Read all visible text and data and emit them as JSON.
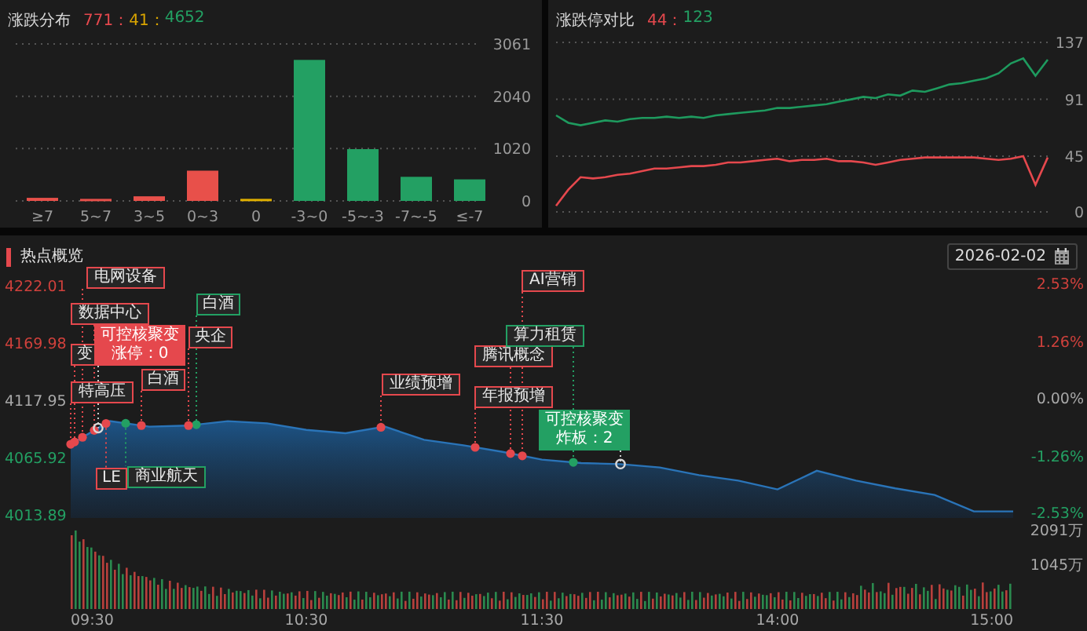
{
  "distribution": {
    "title": "涨跌分布",
    "counts": [
      {
        "text": "771：",
        "color": "#e5484d"
      },
      {
        "text": "41：",
        "color": "#d9a400"
      },
      {
        "text": "4652",
        "color": "#23a063"
      }
    ],
    "chart_data": {
      "type": "bar",
      "categories": [
        "≥7",
        "5~7",
        "3~5",
        "0~3",
        "0",
        "-3~0",
        "-5~-3",
        "-7~-5",
        "≤-7"
      ],
      "series": [
        {
          "color": "#e8504a",
          "values": [
            60,
            40,
            90,
            590,
            null,
            null,
            null,
            null,
            null
          ]
        },
        {
          "color": "#e0b000",
          "values": [
            null,
            null,
            null,
            null,
            40,
            null,
            null,
            null,
            null
          ]
        },
        {
          "color": "#23a063",
          "values": [
            null,
            null,
            null,
            null,
            null,
            2750,
            1010,
            470,
            420
          ]
        }
      ],
      "ylim": [
        0,
        3061
      ],
      "yticks": [
        0,
        1020,
        2040,
        3061
      ]
    }
  },
  "limit_compare": {
    "title": "涨跌停对比",
    "counts": [
      {
        "text": "44：",
        "color": "#e5484d"
      },
      {
        "text": "123",
        "color": "#23a063"
      }
    ],
    "chart_data": {
      "type": "line",
      "series": [
        {
          "color": "#1e9a5e",
          "values": [
            78,
            72,
            70,
            72,
            74,
            73,
            75,
            76,
            76,
            77,
            76,
            77,
            76,
            78,
            79,
            80,
            81,
            82,
            84,
            84,
            85,
            86,
            87,
            89,
            91,
            93,
            92,
            95,
            94,
            98,
            97,
            100,
            103,
            104,
            106,
            108,
            112,
            120,
            124,
            110,
            123
          ]
        },
        {
          "color": "#e5484d",
          "values": [
            5,
            18,
            28,
            27,
            28,
            30,
            31,
            33,
            35,
            35,
            36,
            37,
            37,
            38,
            40,
            40,
            41,
            42,
            43,
            41,
            42,
            42,
            43,
            41,
            41,
            40,
            38,
            40,
            42,
            43,
            44,
            44,
            44,
            44,
            44,
            43,
            42,
            43,
            45,
            22,
            44
          ]
        }
      ],
      "ylim": [
        0,
        137
      ],
      "yticks": [
        0,
        45,
        91,
        137
      ]
    }
  },
  "hotspots": {
    "title": "热点概览",
    "date": "2026-02-02",
    "percent_labels": [
      "2.53%",
      "1.26%",
      "0.00%",
      "-1.26%",
      "-2.53%"
    ],
    "volume_labels": [
      "2091万",
      "1045万"
    ],
    "time_labels": [
      "09:30",
      "10:30",
      "11:30",
      "14:00",
      "15:00"
    ],
    "chart_data": {
      "type": "area",
      "series": [
        {
          "color": "#2a74b8",
          "values": [
            4078,
            4099,
            4094,
            4095,
            4099,
            4097,
            4091,
            4088,
            4094,
            4082,
            4077,
            4071,
            4064,
            4061,
            4060,
            4057,
            4050,
            4045,
            4037,
            4054,
            4045,
            4038,
            4032,
            4017,
            4017
          ]
        }
      ],
      "ylim": [
        4013.89,
        4222.01
      ],
      "yticks": [
        4013.89,
        4065.92,
        4117.95,
        4169.98,
        4222.01
      ]
    },
    "topics": [
      {
        "kind": "tag",
        "label": "电网设备",
        "color": "#e5484d"
      },
      {
        "kind": "tag",
        "label": "AI营销",
        "color": "#e5484d"
      },
      {
        "kind": "tag",
        "label": "数据中心",
        "color": "#e5484d"
      },
      {
        "kind": "tag",
        "label": "白酒",
        "color": "#23a063"
      },
      {
        "kind": "tag",
        "label": "变",
        "color": "#e5484d"
      },
      {
        "kind": "popup",
        "label": "可控核聚变",
        "detail": "涨停：0",
        "color": "#e5484d"
      },
      {
        "kind": "tag",
        "label": "央企",
        "color": "#e5484d"
      },
      {
        "kind": "tag",
        "label": "腾讯概念",
        "color": "#e5484d"
      },
      {
        "kind": "tag",
        "label": "算力租赁",
        "color": "#23a063"
      },
      {
        "kind": "tag",
        "label": "特高压",
        "color": "#e5484d"
      },
      {
        "kind": "tag",
        "label": "白酒",
        "color": "#e5484d"
      },
      {
        "kind": "tag",
        "label": "业绩预增",
        "color": "#e5484d"
      },
      {
        "kind": "tag",
        "label": "年报预增",
        "color": "#e5484d"
      },
      {
        "kind": "popup",
        "label": "可控核聚变",
        "detail": "炸板：2",
        "color": "#23a063"
      },
      {
        "kind": "tag",
        "label": "LE",
        "color": "#e5484d"
      },
      {
        "kind": "tag",
        "label": "商业航天",
        "color": "#23a063"
      }
    ]
  }
}
